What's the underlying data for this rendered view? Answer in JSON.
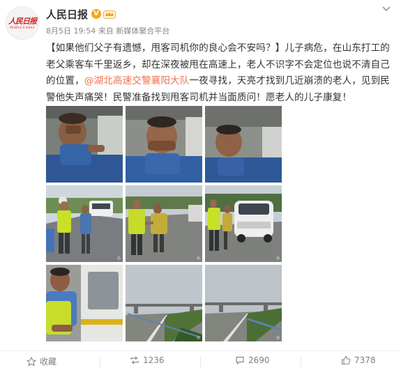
{
  "post": {
    "author": {
      "name": "人民日报",
      "logo_text": "人民日报",
      "logo_subtext": "PEOPLE'S DAILY",
      "verified_icon": "verified-badge-icon",
      "member_icon": "vip-crown-icon"
    },
    "date": "8月5日 19:54",
    "source": "来自 新媒体聚合平台",
    "text": {
      "part1": "【如果他们父子有遗憾，甩客司机你的良心会不安吗？】儿子病危，在山东打工的老父乘客车千里返乡，却在深夜被甩在高速上，老人不识字不会定位也说不清自己的位置，",
      "mention": "@湖北高速交警襄阳大队",
      "part2": "一夜寻找，天亮才找到几近崩溃的老人，见到民警他失声痛哭！民警准备找到甩客司机并当面质问！愿老人的儿子康复！"
    },
    "photos": [
      {
        "scene": "old-man-crying-in-car-1"
      },
      {
        "scene": "old-man-crying-in-car-2"
      },
      {
        "scene": "old-man-crying-in-car-3"
      },
      {
        "scene": "police-with-old-man-on-highway"
      },
      {
        "scene": "police-helping-old-man"
      },
      {
        "scene": "police-by-white-car"
      },
      {
        "scene": "police-in-patrol-car"
      },
      {
        "scene": "empty-highway-overpass-1"
      },
      {
        "scene": "empty-highway-overpass-2"
      }
    ],
    "actions": {
      "favorite": {
        "label": "收藏",
        "icon": "star-icon"
      },
      "repost": {
        "label": "1236",
        "icon": "repost-icon"
      },
      "comment": {
        "label": "2690",
        "icon": "comment-icon"
      },
      "like": {
        "label": "7378",
        "icon": "thumbs-up-icon"
      }
    }
  }
}
